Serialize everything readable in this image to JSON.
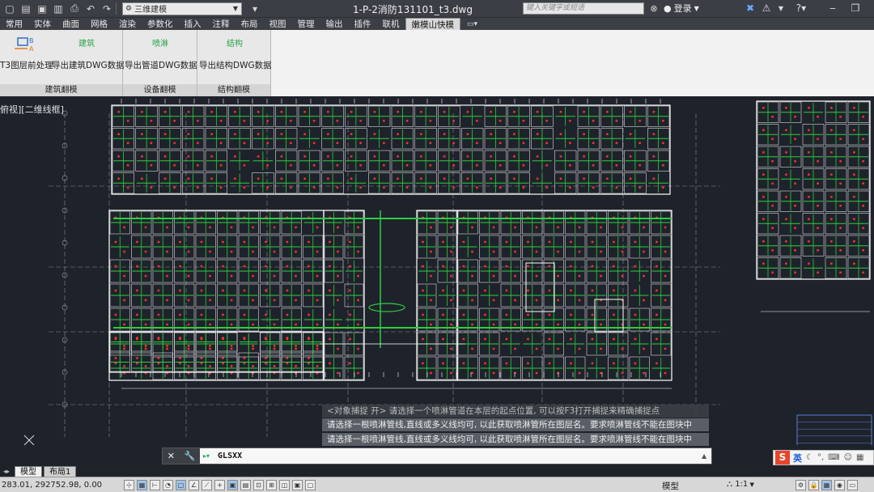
{
  "titlebar": {
    "workspace": "三维建模",
    "doc_title": "1-P-2消防131101_t3.dwg",
    "search_placeholder": "键入关键字或短语",
    "login": "登录"
  },
  "tabs": [
    "常用",
    "实体",
    "曲面",
    "网格",
    "渲染",
    "参数化",
    "插入",
    "注释",
    "布局",
    "视图",
    "管理",
    "输出",
    "插件",
    "联机",
    "嫩模山快模"
  ],
  "active_tab_index": 14,
  "ribbon": {
    "panels": [
      {
        "title": "建筑翻模",
        "buttons": [
          {
            "icon_text": "",
            "label": "T3图层前处理"
          },
          {
            "icon_text": "建筑",
            "label": "导出建筑DWG数据"
          }
        ]
      },
      {
        "title": "设备翻模",
        "buttons": [
          {
            "icon_text": "喷淋",
            "label": "导出管道DWG数据"
          }
        ]
      },
      {
        "title": "结构翻模",
        "buttons": [
          {
            "icon_text": "结构",
            "label": "导出结构DWG数据"
          }
        ]
      }
    ]
  },
  "viewport_label": "俯视][二维线框]",
  "command": {
    "history": [
      "<对象捕捉 开> 请选择一个喷淋管道在本层的起点位置, 可以按F3打开捕捉来精确捕捉点",
      "请选择一根喷淋管线,直线或多义线均可, 以此获取喷淋管所在图层名。要求喷淋管线不能在图块中",
      "请选择一根喷淋管线,直线或多义线均可, 以此获取喷淋管所在图层名。要求喷淋管线不能在图块中"
    ],
    "input_value": "GLSXX"
  },
  "layout_tabs": [
    "模型",
    "布局1"
  ],
  "status": {
    "coords": "283.01, 292752.98, 0.00",
    "model": "模型",
    "scale": "1:1"
  },
  "ime": {
    "mode": "英"
  },
  "colors": {
    "background": "#1e232b",
    "walls": "#ffffff",
    "pipes": "#2ecc40",
    "heads": "#ff3030",
    "grid": "#8a8a8a"
  }
}
